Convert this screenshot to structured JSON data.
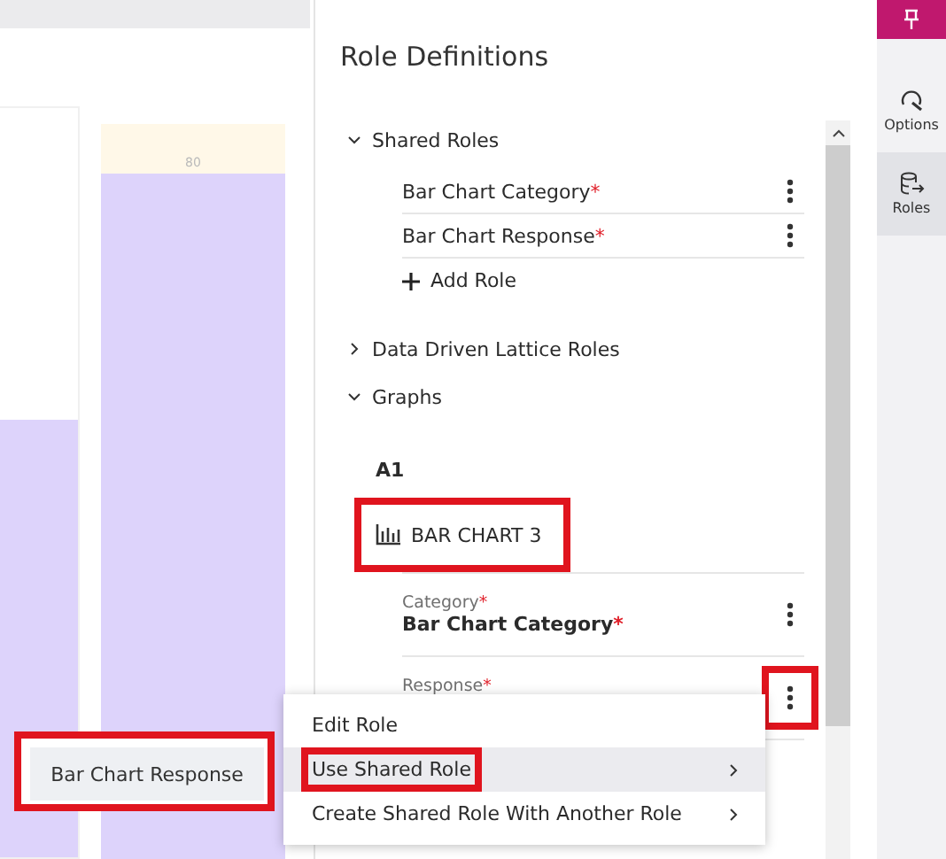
{
  "canvas": {
    "bar_label": "80"
  },
  "popup": {
    "label": "Bar Chart Response",
    "highlighted": true
  },
  "panel": {
    "title": "Role Definitions",
    "sections": [
      {
        "label": "Shared Roles",
        "expanded": true,
        "items": [
          {
            "label": "Bar Chart Category",
            "mark": "*"
          },
          {
            "label": "Bar Chart Response",
            "mark": "*"
          }
        ],
        "add_label": "Add Role"
      },
      {
        "label": "Data Driven Lattice Roles",
        "expanded": false
      },
      {
        "label": "Graphs",
        "expanded": true
      }
    ],
    "graph": {
      "group": "A1",
      "title": "BAR CHART 3",
      "highlighted": true,
      "roles": [
        {
          "label": "Category",
          "value": "Bar Chart Category",
          "mark": "*"
        },
        {
          "label": "Response",
          "mark": "*",
          "highlighted": true
        }
      ]
    }
  },
  "context_menu": {
    "items": [
      {
        "label": "Edit Role",
        "selected": false,
        "submenu": false
      },
      {
        "label": "Use Shared Role",
        "selected": true,
        "submenu": true,
        "highlighted": true
      },
      {
        "label": "Create Shared Role With Another Role",
        "selected": false,
        "submenu": true
      }
    ]
  },
  "rail": {
    "items": [
      {
        "label": "Options",
        "kind": "options",
        "selected": false
      },
      {
        "label": "Roles",
        "kind": "roles",
        "selected": true
      }
    ]
  }
}
